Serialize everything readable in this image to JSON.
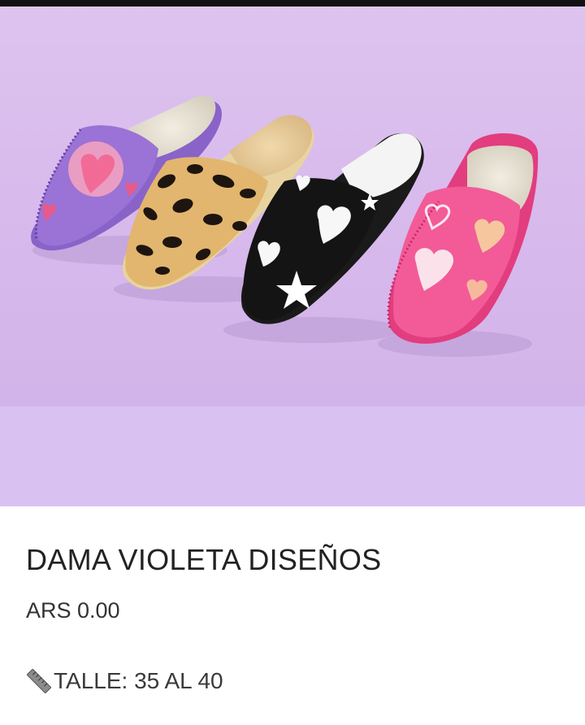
{
  "product": {
    "title": "DAMA VIOLETA DISEÑOS",
    "price": "ARS 0.00",
    "size_text": "TALLE: 35 AL 40",
    "size_icon": "ruler-icon"
  },
  "photo": {
    "subject": "four-slippers",
    "background_color": "#d7b9ec"
  }
}
